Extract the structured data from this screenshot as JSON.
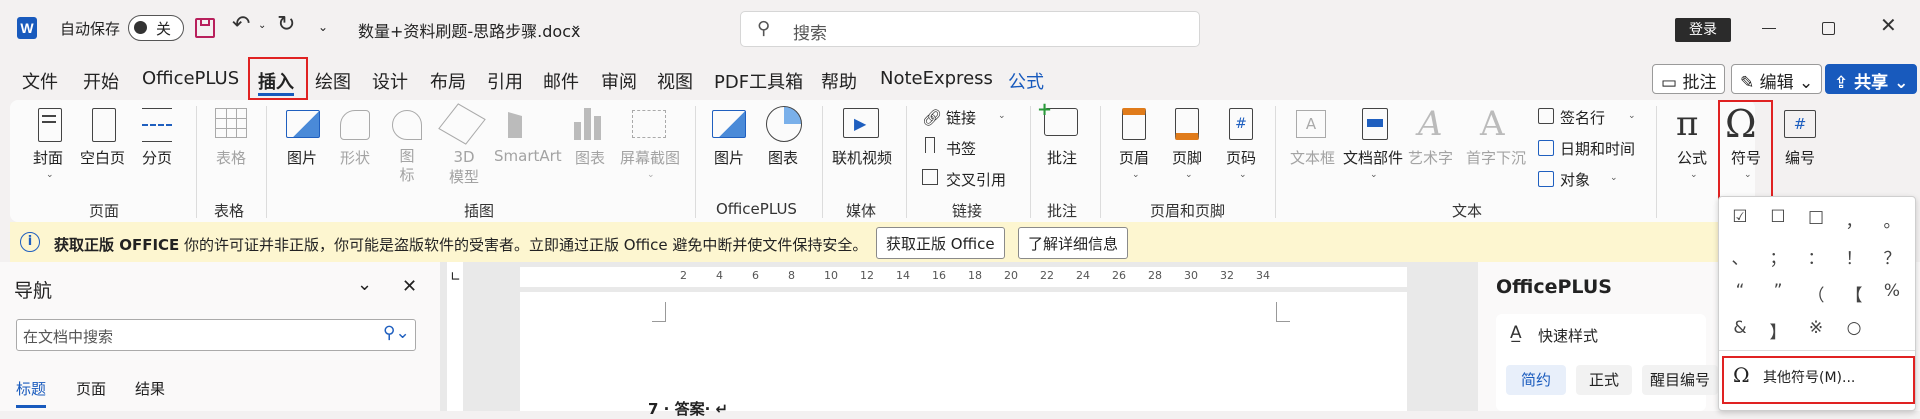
{
  "titlebar": {
    "autosave_label": "自动保存",
    "autosave_state": "关",
    "filename": "数量+资料刷题-思路步骤.docx",
    "search_placeholder": "搜索",
    "login_label": "登录"
  },
  "tabs": [
    "文件",
    "开始",
    "OfficePLUS",
    "插入",
    "绘图",
    "设计",
    "布局",
    "引用",
    "邮件",
    "审阅",
    "视图",
    "PDF工具箱",
    "帮助",
    "NoteExpress",
    "公式"
  ],
  "active_tab": "插入",
  "ribbon_right": {
    "comment": "批注",
    "edit": "编辑",
    "share": "共享"
  },
  "ribbon": {
    "cover": "封面",
    "blank_page": "空白页",
    "page_break": "分页",
    "table": "表格",
    "picture": "图片",
    "shapes": "形状",
    "icons": "图标",
    "model3d": "3D 模型",
    "smartart": "SmartArt",
    "chart": "图表",
    "screenshot": "屏幕截图",
    "op_picture": "图片",
    "op_chart": "图表",
    "online_video": "联机视频",
    "link": "链接",
    "bookmark": "书签",
    "crossref": "交叉引用",
    "comment_btn": "批注",
    "header": "页眉",
    "footer": "页脚",
    "page_number": "页码",
    "textbox": "文本框",
    "quick_parts": "文档部件",
    "wordart": "艺术字",
    "dropcap": "首字下沉",
    "signature_line": "签名行",
    "datetime": "日期和时间",
    "object": "对象",
    "equation": "公式",
    "symbol": "符号",
    "numbering": "编号",
    "groups": {
      "pages": "页面",
      "tables": "表格",
      "illustrations": "插图",
      "officeplus": "OfficePLUS",
      "media": "媒体",
      "links": "链接",
      "comments": "批注",
      "header_footer": "页眉和页脚",
      "text": "文本"
    }
  },
  "message_bar": {
    "title": "获取正版 OFFICE",
    "text": "你的许可证并非正版，你可能是盗版软件的受害者。立即通过正版 Office 避免中断并使文件保持安全。",
    "btn_get": "获取正版 Office",
    "btn_more": "了解详细信息"
  },
  "nav": {
    "title": "导航",
    "search_placeholder": "在文档中搜索",
    "tabs": [
      "标题",
      "页面",
      "结果"
    ]
  },
  "ruler_numbers": [
    "2",
    "4",
    "6",
    "8",
    "10",
    "12",
    "14",
    "16",
    "18",
    "20",
    "22",
    "24",
    "26",
    "28",
    "30",
    "32",
    "34"
  ],
  "document": {
    "line1": "7 · 答案· ↵"
  },
  "officeplus_pane": {
    "title": "OfficePLUS",
    "quick_style": "快速样式",
    "styles": [
      "简约",
      "正式",
      "醒目编号"
    ]
  },
  "symbols": [
    "☑",
    "☐",
    "□",
    "，",
    "。",
    "、",
    "；",
    "：",
    "！",
    "？",
    "“",
    "”",
    "（",
    "【",
    "%",
    "&",
    "】",
    "※",
    "○"
  ],
  "more_symbols": "其他符号(M)..."
}
